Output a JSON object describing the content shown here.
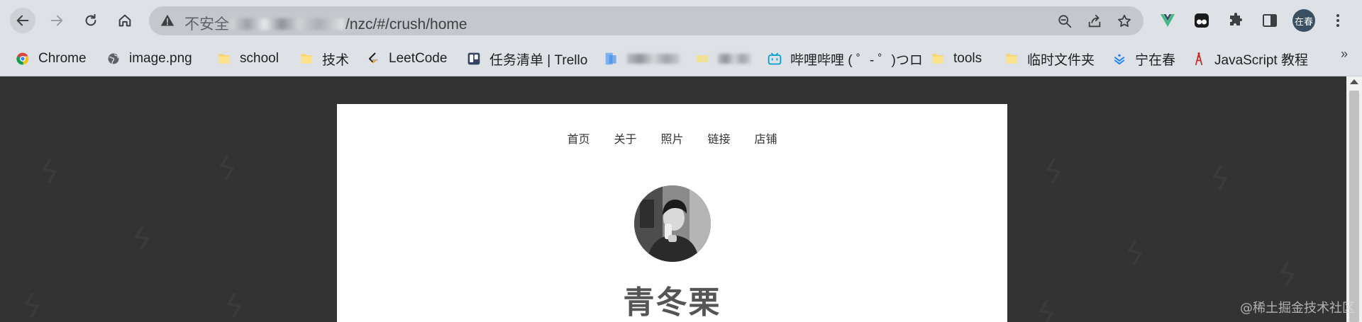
{
  "browser": {
    "address_bar": {
      "security_label": "不安全",
      "url_visible": "/nzc/#/crush/home"
    },
    "profile_chip": "在春"
  },
  "bookmarks": [
    {
      "label": "Chrome",
      "icon": "chrome-icon"
    },
    {
      "label": "image.png",
      "icon": "globe-icon"
    },
    {
      "label": "school",
      "icon": "folder-icon"
    },
    {
      "label": "技术",
      "icon": "folder-icon"
    },
    {
      "label": "LeetCode",
      "icon": "leetcode-icon"
    },
    {
      "label": "任务清单 | Trello",
      "icon": "trello-icon"
    },
    {
      "label": "",
      "icon": "blurred-site-icon"
    },
    {
      "label": "",
      "icon": "blurred-site-icon"
    },
    {
      "label": "哔哩哔哩 ( ゜- ゜)つロ",
      "icon": "bilibili-icon"
    },
    {
      "label": "tools",
      "icon": "folder-icon"
    },
    {
      "label": "临时文件夹",
      "icon": "folder-icon"
    },
    {
      "label": "宁在春",
      "icon": "juejin-icon"
    },
    {
      "label": "JavaScript 教程",
      "icon": "tower-icon"
    }
  ],
  "bookmarks_overflow": "»",
  "site": {
    "nav": [
      "首页",
      "关于",
      "照片",
      "链接",
      "店铺"
    ],
    "title": "青冬栗"
  },
  "watermark": "@稀土掘金技术社区",
  "colors": {
    "chrome_bg": "#dee1e6",
    "omnibox_bg": "#c4c7cc",
    "page_bg": "#333333",
    "card_bg": "#ffffff",
    "folder": "#f6d66b",
    "vue_green": "#41b883"
  }
}
